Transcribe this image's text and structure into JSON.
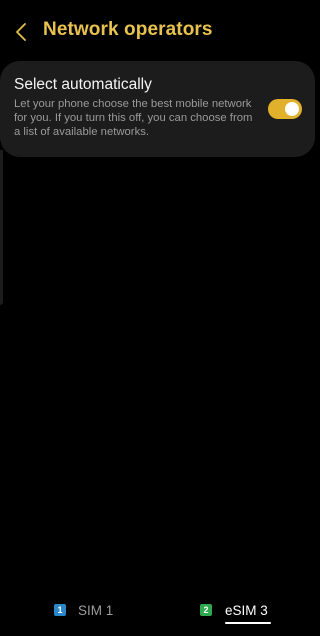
{
  "header": {
    "back_icon": "chevron-left-icon",
    "title": "Network operators"
  },
  "setting": {
    "title": "Select automatically",
    "description": "Let your phone choose the best mobile network for you. If you turn this off, you can choose from a list of available networks.",
    "toggle_on": true
  },
  "sim_tabs": [
    {
      "badge": "1",
      "label": "SIM 1",
      "selected": false
    },
    {
      "badge": "2",
      "label": "eSIM 3",
      "selected": true
    }
  ],
  "colors": {
    "background": "#000000",
    "accent": "#e8c24e",
    "toggle": "#e1b12c",
    "card": "#1c1c1c",
    "sim1_badge": "#2a87c9",
    "sim2_badge": "#2fa84f"
  }
}
